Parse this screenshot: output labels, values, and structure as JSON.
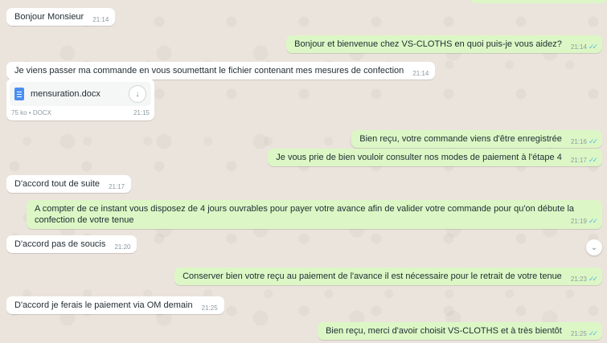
{
  "messages": [
    {
      "dir": "in",
      "text": "Bonjour Monsieur",
      "time": "21:14"
    },
    {
      "dir": "out",
      "text": "Bonjour et bienvenue chez VS-CLOTHS en quoi puis-je vous aidez?",
      "time": "21:14"
    },
    {
      "dir": "in",
      "text": "Je viens passer ma commande en vous soumettant le fichier contenant mes mesures de confection",
      "time": "21:14"
    },
    {
      "dir": "out",
      "text": "Bien reçu, votre commande viens d'être enregistrée",
      "time": "21:16"
    },
    {
      "dir": "out",
      "text": "Je vous prie de bien vouloir consulter nos modes de paiement à l'étape 4",
      "time": "21:17"
    },
    {
      "dir": "in",
      "text": "D'accord tout de suite",
      "time": "21:17"
    },
    {
      "dir": "out",
      "text": "A compter de ce instant vous disposez de 4 jours ouvrables pour payer votre avance afin de valider votre commande pour qu'on débute la confection de votre tenue",
      "time": "21:19"
    },
    {
      "dir": "in",
      "text": "D'accord pas de soucis",
      "time": "21:20"
    },
    {
      "dir": "out",
      "text": "Conserver bien votre reçu au paiement de l'avance il est nécessaire pour le retrait de votre tenue",
      "time": "21:23"
    },
    {
      "dir": "in",
      "text": "D'accord je ferais le paiement via OM demain",
      "time": "21:25"
    },
    {
      "dir": "out",
      "text": "Bien reçu, merci d'avoir choisit VS-CLOTHS et à très bientôt",
      "time": "21:25"
    }
  ],
  "document": {
    "filename": "mensuration.docx",
    "meta": "75 ko • DOCX",
    "time": "21:15"
  },
  "icons": {
    "read_receipt": "✓✓",
    "download": "↓",
    "scroll_down": "⌄"
  },
  "colors": {
    "incoming": "#ffffff",
    "outgoing": "#dcf7c5",
    "background": "#ebe4dc",
    "check": "#53bdeb"
  }
}
